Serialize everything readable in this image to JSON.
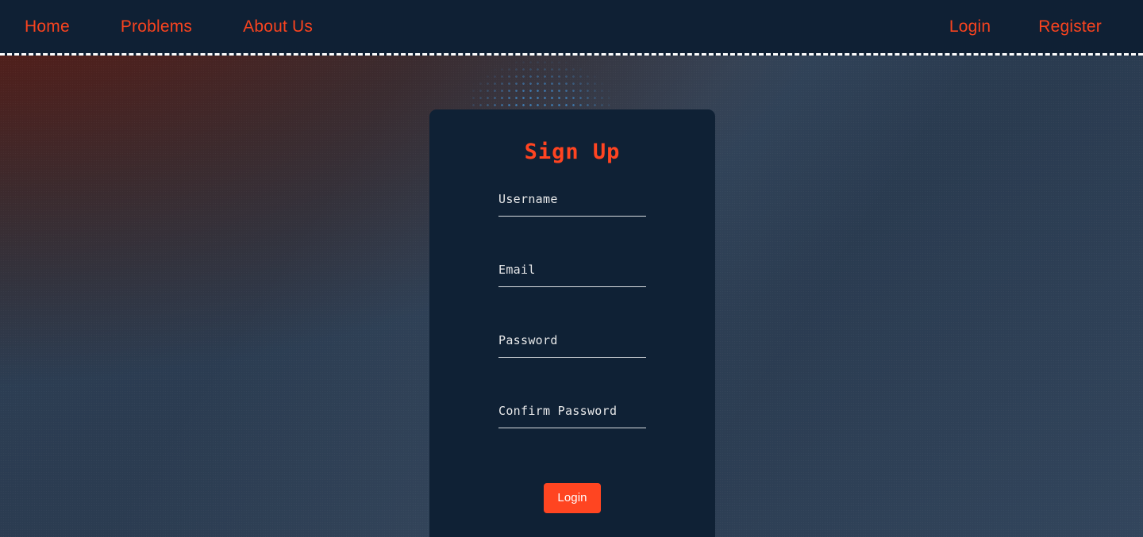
{
  "navbar": {
    "left_links": [
      {
        "label": "Home",
        "name": "nav-link-home"
      },
      {
        "label": "Problems",
        "name": "nav-link-problems"
      },
      {
        "label": "About Us",
        "name": "nav-link-about-us"
      }
    ],
    "right_links": [
      {
        "label": "Login",
        "name": "nav-link-login"
      },
      {
        "label": "Register",
        "name": "nav-link-register"
      }
    ],
    "background_color": "#0f2034",
    "link_color": "#f8431f",
    "border_style": "dashed-white"
  },
  "card": {
    "title": "Sign Up",
    "title_color": "#ff4421",
    "background_color": "#0f2135",
    "fields": [
      {
        "label": "Username",
        "value": "",
        "placeholder": "",
        "type": "text",
        "name": "username"
      },
      {
        "label": "Email",
        "value": "",
        "placeholder": "",
        "type": "text",
        "name": "email"
      },
      {
        "label": "Password",
        "value": "",
        "placeholder": "",
        "type": "password",
        "name": "password"
      },
      {
        "label": "Confirm Password",
        "value": "",
        "placeholder": "",
        "type": "password",
        "name": "confirm-password"
      }
    ],
    "submit_label": "Login",
    "submit_color": "#ff4521"
  },
  "background": {
    "glow_color": "#5a1b14",
    "base_color": "#2b3d52",
    "halftone_dot_color": "#3f7fb8"
  }
}
